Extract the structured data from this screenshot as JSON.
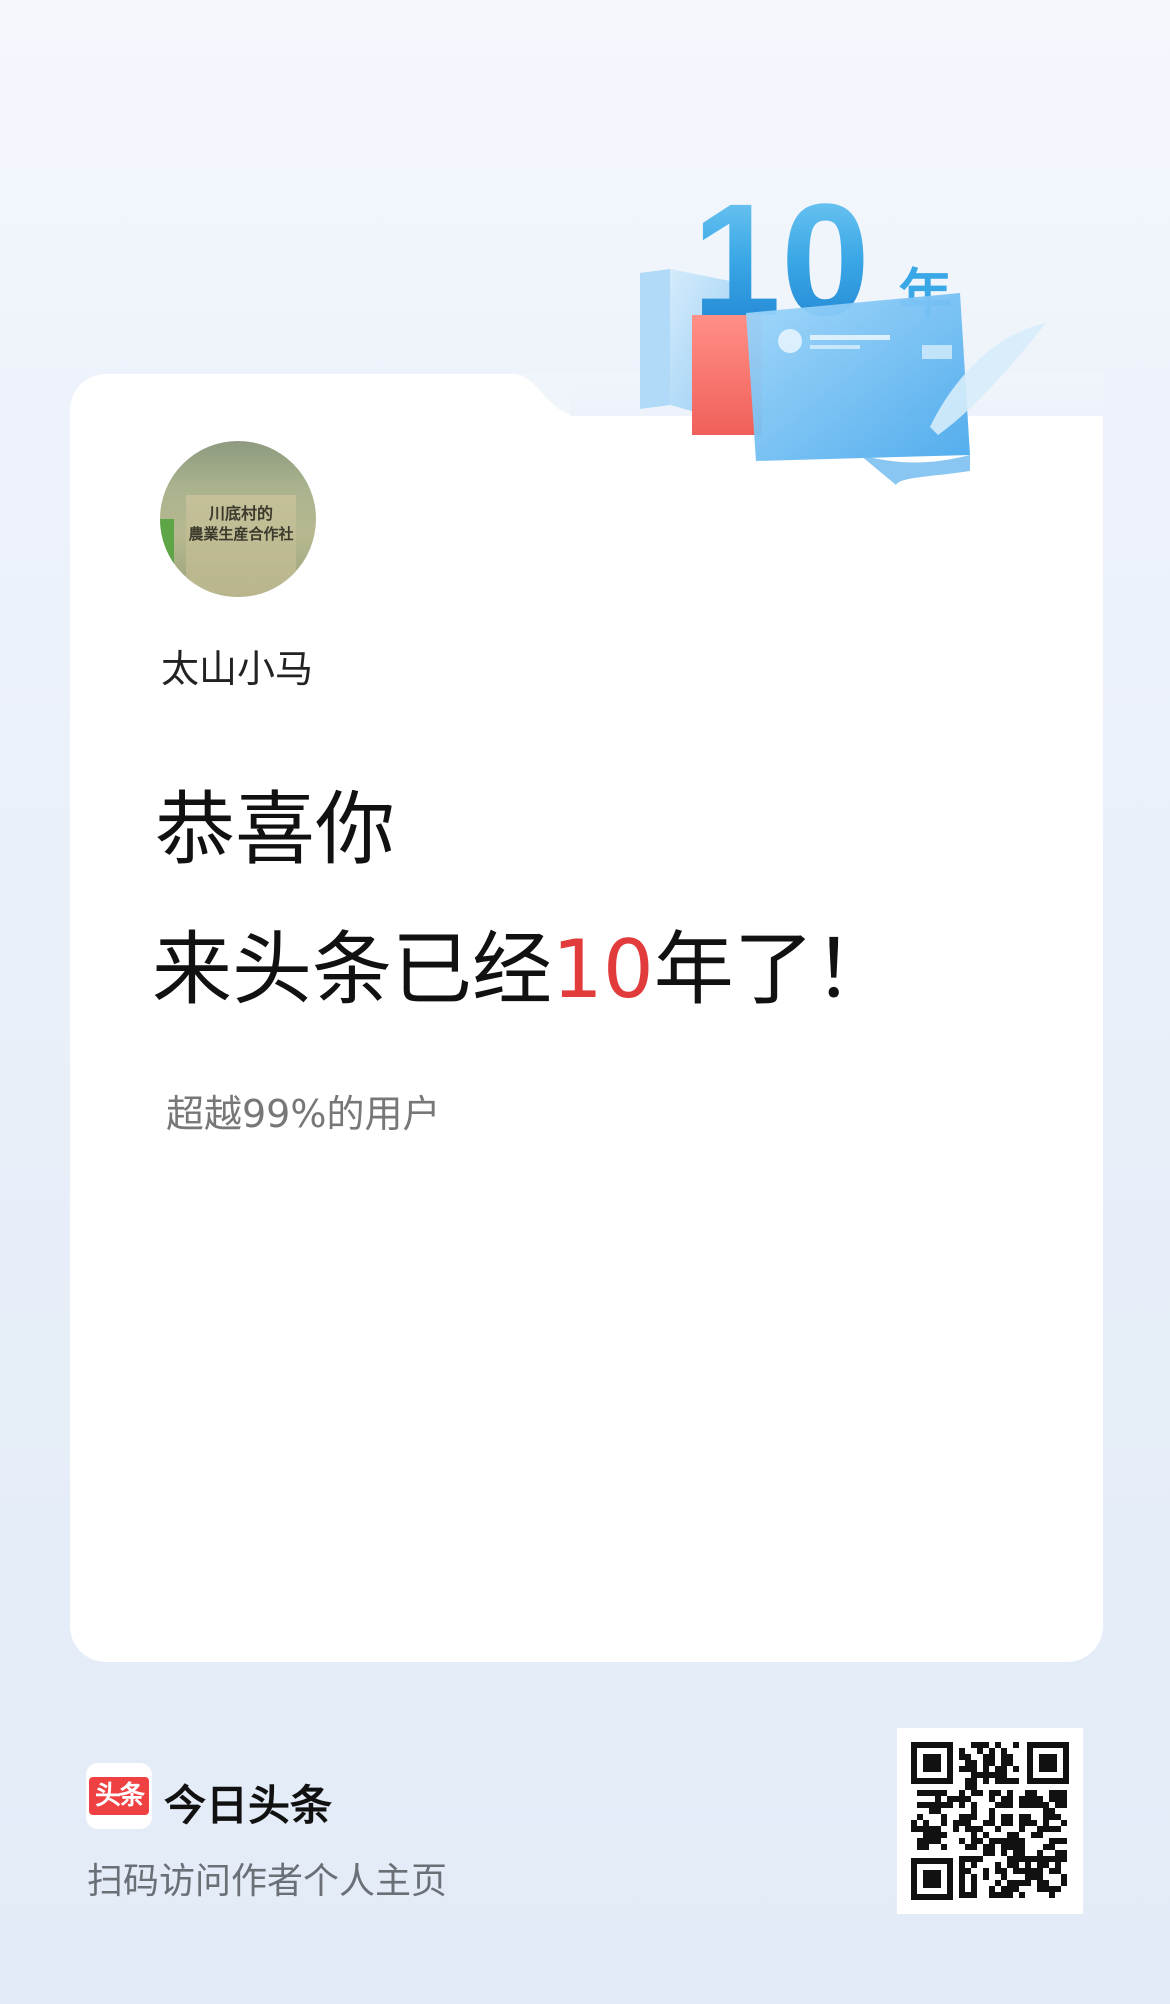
{
  "anniversary_badge": {
    "number": "10",
    "unit": "年"
  },
  "avatar": {
    "book_title_line1": "川底村的",
    "book_title_line2": "農業生産合作社"
  },
  "user": {
    "name": "太山小马"
  },
  "headline": {
    "line1": "恭喜你",
    "line2_prefix": "来头条已经",
    "line2_number": "10",
    "line2_suffix": "年了！"
  },
  "stats": {
    "subtext": "超越99%的用户"
  },
  "footer": {
    "logo_text": "头条",
    "brand_name": "今日头条",
    "scan_hint": "扫码访问作者个人主页"
  },
  "colors": {
    "accent_red": "#e23b3b",
    "brand_red": "#f04142",
    "badge_blue": "#3aa7e6"
  }
}
